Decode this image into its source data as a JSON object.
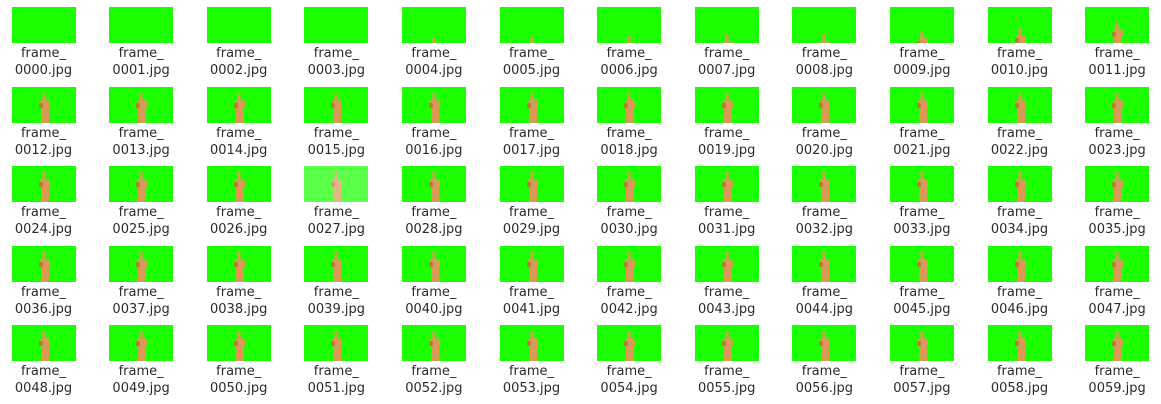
{
  "file_manager": {
    "view": "icon-grid",
    "thumbnail_color": "#1bff00",
    "hand_color": "#d89a55",
    "hand_shadow": "#b9783c",
    "label_color": "#2b2b2b",
    "thumbnail_icon": "hand-thumbnail-icon",
    "files": [
      {
        "line1": "frame_",
        "line2": "0000.jpg",
        "hand": 0
      },
      {
        "line1": "frame_",
        "line2": "0001.jpg",
        "hand": 0
      },
      {
        "line1": "frame_",
        "line2": "0002.jpg",
        "hand": 0
      },
      {
        "line1": "frame_",
        "line2": "0003.jpg",
        "hand": 0
      },
      {
        "line1": "frame_",
        "line2": "0004.jpg",
        "hand": 0.2
      },
      {
        "line1": "frame_",
        "line2": "0005.jpg",
        "hand": 0.2
      },
      {
        "line1": "frame_",
        "line2": "0006.jpg",
        "hand": 0.25
      },
      {
        "line1": "frame_",
        "line2": "0007.jpg",
        "hand": 0.3
      },
      {
        "line1": "frame_",
        "line2": "0008.jpg",
        "hand": 0.3
      },
      {
        "line1": "frame_",
        "line2": "0009.jpg",
        "hand": 0.4
      },
      {
        "line1": "frame_",
        "line2": "0010.jpg",
        "hand": 0.5
      },
      {
        "line1": "frame_",
        "line2": "0011.jpg",
        "hand": 0.7
      },
      {
        "line1": "frame_",
        "line2": "0012.jpg",
        "hand": 1
      },
      {
        "line1": "frame_",
        "line2": "0013.jpg",
        "hand": 1
      },
      {
        "line1": "frame_",
        "line2": "0014.jpg",
        "hand": 1
      },
      {
        "line1": "frame_",
        "line2": "0015.jpg",
        "hand": 1
      },
      {
        "line1": "frame_",
        "line2": "0016.jpg",
        "hand": 1
      },
      {
        "line1": "frame_",
        "line2": "0017.jpg",
        "hand": 1
      },
      {
        "line1": "frame_",
        "line2": "0018.jpg",
        "hand": 1
      },
      {
        "line1": "frame_",
        "line2": "0019.jpg",
        "hand": 1
      },
      {
        "line1": "frame_",
        "line2": "0020.jpg",
        "hand": 1
      },
      {
        "line1": "frame_",
        "line2": "0021.jpg",
        "hand": 1
      },
      {
        "line1": "frame_",
        "line2": "0022.jpg",
        "hand": 1
      },
      {
        "line1": "frame_",
        "line2": "0023.jpg",
        "hand": 1
      },
      {
        "line1": "frame_",
        "line2": "0024.jpg",
        "hand": 1
      },
      {
        "line1": "frame_",
        "line2": "0025.jpg",
        "hand": 1
      },
      {
        "line1": "frame_",
        "line2": "0026.jpg",
        "hand": 1
      },
      {
        "line1": "frame_",
        "line2": "0027.jpg",
        "hand": 1,
        "washed": true
      },
      {
        "line1": "frame_",
        "line2": "0028.jpg",
        "hand": 1
      },
      {
        "line1": "frame_",
        "line2": "0029.jpg",
        "hand": 1
      },
      {
        "line1": "frame_",
        "line2": "0030.jpg",
        "hand": 1
      },
      {
        "line1": "frame_",
        "line2": "0031.jpg",
        "hand": 1
      },
      {
        "line1": "frame_",
        "line2": "0032.jpg",
        "hand": 1
      },
      {
        "line1": "frame_",
        "line2": "0033.jpg",
        "hand": 1
      },
      {
        "line1": "frame_",
        "line2": "0034.jpg",
        "hand": 1
      },
      {
        "line1": "frame_",
        "line2": "0035.jpg",
        "hand": 1
      },
      {
        "line1": "frame_",
        "line2": "0036.jpg",
        "hand": 1
      },
      {
        "line1": "frame_",
        "line2": "0037.jpg",
        "hand": 1
      },
      {
        "line1": "frame_",
        "line2": "0038.jpg",
        "hand": 1
      },
      {
        "line1": "frame_",
        "line2": "0039.jpg",
        "hand": 1
      },
      {
        "line1": "frame_",
        "line2": "0040.jpg",
        "hand": 1
      },
      {
        "line1": "frame_",
        "line2": "0041.jpg",
        "hand": 1
      },
      {
        "line1": "frame_",
        "line2": "0042.jpg",
        "hand": 1
      },
      {
        "line1": "frame_",
        "line2": "0043.jpg",
        "hand": 1
      },
      {
        "line1": "frame_",
        "line2": "0044.jpg",
        "hand": 1
      },
      {
        "line1": "frame_",
        "line2": "0045.jpg",
        "hand": 1
      },
      {
        "line1": "frame_",
        "line2": "0046.jpg",
        "hand": 1
      },
      {
        "line1": "frame_",
        "line2": "0047.jpg",
        "hand": 1
      },
      {
        "line1": "frame_",
        "line2": "0048.jpg",
        "hand": 1
      },
      {
        "line1": "frame_",
        "line2": "0049.jpg",
        "hand": 1
      },
      {
        "line1": "frame_",
        "line2": "0050.jpg",
        "hand": 1
      },
      {
        "line1": "frame_",
        "line2": "0051.jpg",
        "hand": 1
      },
      {
        "line1": "frame_",
        "line2": "0052.jpg",
        "hand": 1
      },
      {
        "line1": "frame_",
        "line2": "0053.jpg",
        "hand": 1
      },
      {
        "line1": "frame_",
        "line2": "0054.jpg",
        "hand": 1
      },
      {
        "line1": "frame_",
        "line2": "0055.jpg",
        "hand": 1
      },
      {
        "line1": "frame_",
        "line2": "0056.jpg",
        "hand": 1
      },
      {
        "line1": "frame_",
        "line2": "0057.jpg",
        "hand": 1
      },
      {
        "line1": "frame_",
        "line2": "0058.jpg",
        "hand": 1
      },
      {
        "line1": "frame_",
        "line2": "0059.jpg",
        "hand": 1
      }
    ]
  }
}
